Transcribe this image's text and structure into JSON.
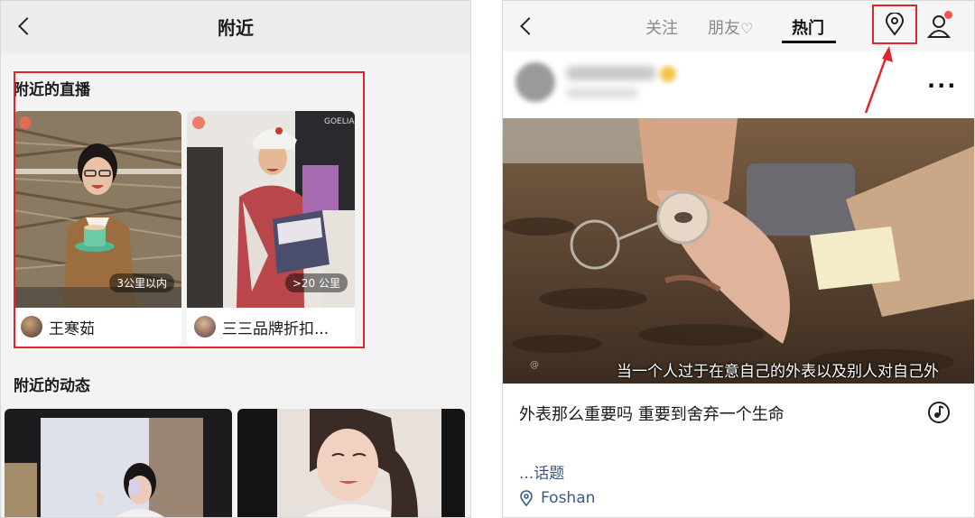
{
  "left": {
    "title": "附近",
    "live_section_title": "附近的直播",
    "live_cards": [
      {
        "distance": "3公里以内",
        "host": "王寒茹"
      },
      {
        "distance": ">20 公里",
        "host": "三三品牌折扣..."
      }
    ],
    "feed_section_title": "附近的动态"
  },
  "right": {
    "tabs": [
      "关注",
      "朋友",
      "热门"
    ],
    "active_tab": "热门",
    "video_subtitle": "当一个人过于在意自己的外表以及别人对自己外",
    "caption": "外表那么重要吗 重要到舍弃一个生命",
    "topic": "...话题",
    "location": "Foshan"
  },
  "colors": {
    "highlight_red": "#e0242b",
    "link_blue": "#3b5a86",
    "live_dot": "#f06a50"
  },
  "icons": [
    "back-icon",
    "location-pin-icon",
    "person-icon",
    "heart-icon",
    "more-icon",
    "music-icon",
    "live-indicator-icon"
  ]
}
